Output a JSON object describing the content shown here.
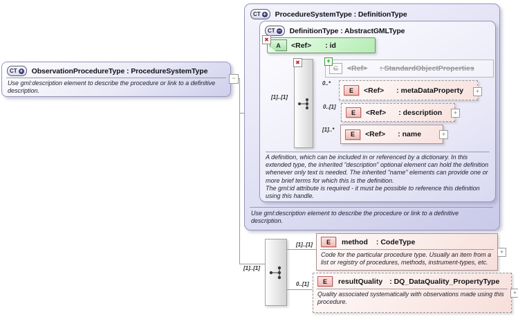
{
  "icons": {
    "complex_type": "CT",
    "expanded_badge": "+",
    "collapsed_badge": "−",
    "attribute": "A",
    "group": "G",
    "element": "E",
    "delete_x": "✖",
    "add_plus": "+",
    "expand_plus": "+",
    "collapse_minus": "−"
  },
  "left_box": {
    "title": "ObservationProcedureType : ProcedureSystemType",
    "description": "Use gml:description element to describe the procedure or link to a definitive description."
  },
  "outer_box": {
    "title": "ProcedureSystemType : DefinitionType",
    "description": "Use gml:description element to describe the procedure or link to a definitive description."
  },
  "inner_box": {
    "title": "DefinitionType : AbstractGMLType",
    "description_para1": "A definition, which can be included in or referenced by a dictionary. In this extended type, the inherited \"description\" optional element can hold the definition whenever only text is needed. The inherited \"name\" elements can provide one or more brief terms for which this is the definition.",
    "description_para2": "The gml:id attribute is required - it must be possible to reference this definition using this handle."
  },
  "attribute_id": {
    "ref": "<Ref>",
    "type": ": id"
  },
  "inner_sequence_cardinality": "[1]..[1]",
  "group_standard": {
    "ref": "<Ref>",
    "type": ": StandardObjectProperties"
  },
  "element_metadata": {
    "cardinality": "0..*",
    "ref": "<Ref>",
    "type": ": metaDataProperty"
  },
  "element_description": {
    "cardinality": "0..[1]",
    "ref": "<Ref>",
    "type": ": description"
  },
  "element_name": {
    "cardinality": "[1]..*",
    "ref": "<Ref>",
    "type": ": name"
  },
  "main_sequence_cardinality": "[1]..[1]",
  "element_method": {
    "cardinality": "[1]..[1]",
    "name": "method",
    "type": ": CodeType",
    "description": "Code for the particular procedure type. Usually an item from a list or registry of procedures, methods, instrument-types, etc."
  },
  "element_result_quality": {
    "cardinality": "0..[1]",
    "name": "resultQuality",
    "type": ": DQ_DataQuality_PropertyType",
    "description": "Quality associated systematically with observations made using this procedure."
  },
  "colors": {
    "lavender_border": "#9595b8",
    "pink_border": "#c06060",
    "green_border": "#6b8a6b",
    "connector": "#999999",
    "red_x": "#cc2222",
    "green_plus": "#1f8a1f"
  }
}
